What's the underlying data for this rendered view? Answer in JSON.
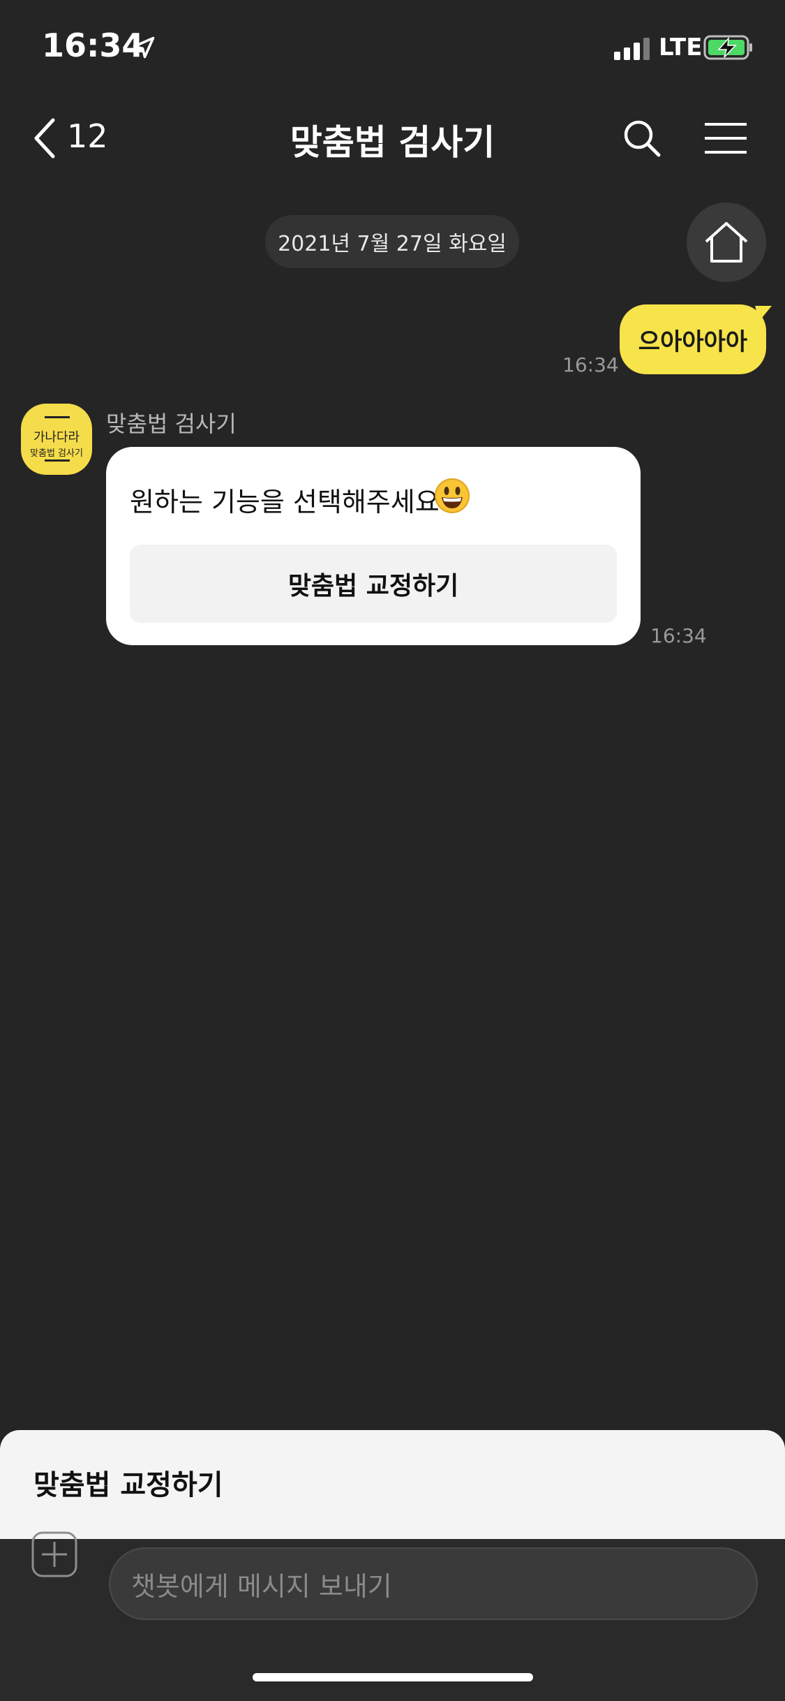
{
  "status_bar": {
    "time": "16:34",
    "network": "LTE"
  },
  "nav": {
    "back_count": "12",
    "title": "맞춤법 검사기"
  },
  "chat": {
    "date_divider": "2021년 7월 27일 화요일",
    "messages": [
      {
        "from": "me",
        "text": "으아아아아",
        "time": "16:34"
      },
      {
        "from": "bot",
        "sender_name": "맞춤법 검사기",
        "text": "원하는 기능을 선택해주세요",
        "button_label": "맞춤법 교정하기",
        "time": "16:34"
      }
    ]
  },
  "avatar": {
    "main_text": "가나다라",
    "sub_text": "맞춤법 검사기"
  },
  "quick_replies": [
    "맞춤법 교정하기"
  ],
  "input": {
    "placeholder": "챗봇에게 메시지 보내기"
  },
  "colors": {
    "background": "#252525",
    "accent_yellow": "#f7e34a",
    "battery_green": "#4cd964"
  }
}
